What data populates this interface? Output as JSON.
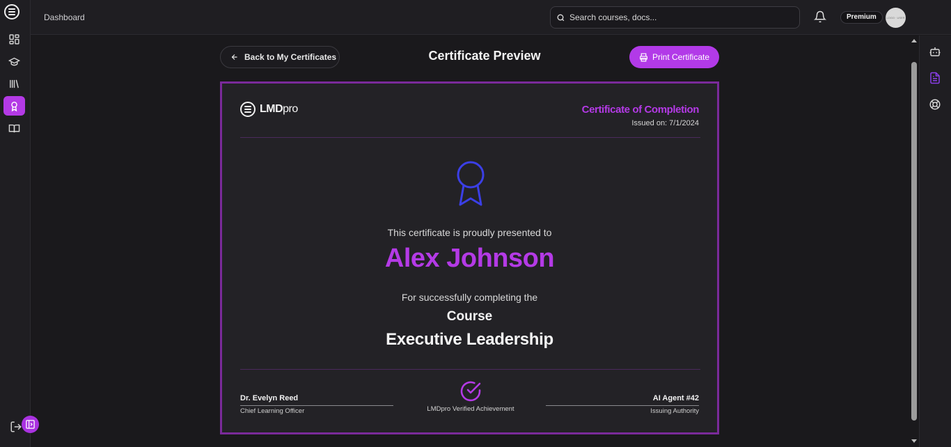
{
  "header": {
    "breadcrumb": "Dashboard",
    "search_placeholder": "Search courses, docs...",
    "plan_badge": "Premium",
    "avatar_text": "LOGO · USER"
  },
  "sidebar": {
    "items": [
      {
        "name": "dashboard",
        "icon": "grid-icon",
        "active": false
      },
      {
        "name": "courses",
        "icon": "graduation-cap-icon",
        "active": false
      },
      {
        "name": "library",
        "icon": "library-icon",
        "active": false
      },
      {
        "name": "certificates",
        "icon": "award-icon",
        "active": true
      },
      {
        "name": "notebook",
        "icon": "book-open-icon",
        "active": false
      }
    ]
  },
  "page": {
    "back_label": "Back to My Certificates",
    "title": "Certificate Preview",
    "print_label": "Print Certificate"
  },
  "certificate": {
    "brand_bold": "LMD",
    "brand_light": "pro",
    "type": "Certificate of Completion",
    "issued": "Issued on: 7/1/2024",
    "presented_text": "This certificate is proudly presented to",
    "recipient": "Alex Johnson",
    "completing_text": "For successfully completing the",
    "course_type": "Course",
    "course_name": "Executive Leadership",
    "signatory_left": {
      "name": "Dr. Evelyn Reed",
      "role": "Chief Learning Officer"
    },
    "verified_text": "LMDpro Verified Achievement",
    "signatory_right": {
      "name": "AI Agent #42",
      "role": "Issuing Authority"
    }
  },
  "colors": {
    "accent": "#b43ae6",
    "frame": "#7a2a9a",
    "award_icon": "#3b3fe6"
  }
}
